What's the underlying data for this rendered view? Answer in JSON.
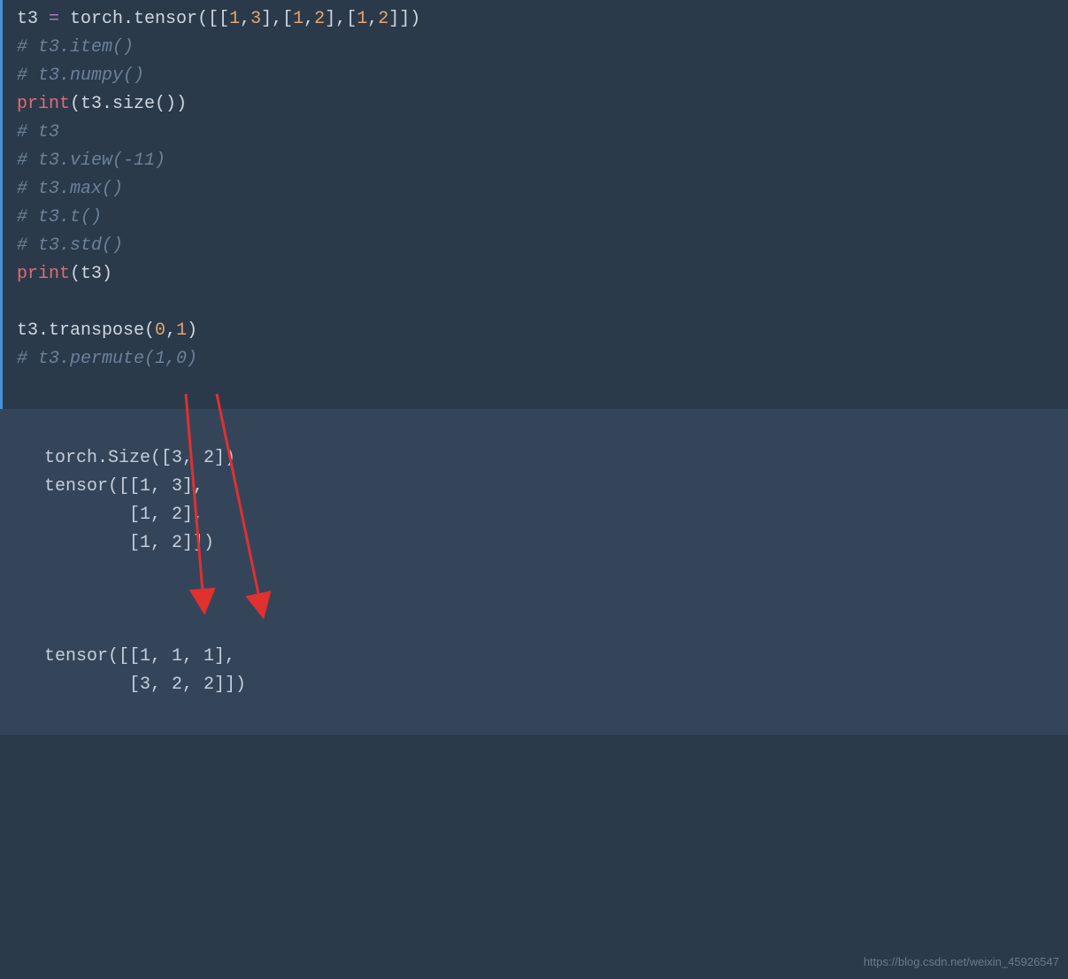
{
  "code": {
    "line1": {
      "var": "t3",
      "op": " = ",
      "method": "torch.tensor",
      "open": "([[",
      "n1": "1",
      "c1": ",",
      "n2": "3",
      "c2": "],[",
      "n3": "1",
      "c3": ",",
      "n4": "2",
      "c4": "],[",
      "n5": "1",
      "c5": ",",
      "n6": "2",
      "close": "]])"
    },
    "line2": "# t3.item()",
    "line3": "# t3.numpy()",
    "line4": {
      "builtin": "print",
      "open": "(",
      "var": "t3.size",
      "call": "()",
      "close": ")"
    },
    "line5": "# t3",
    "line6": "# t3.view(-11)",
    "line7": "# t3.max()",
    "line8": "# t3.t()",
    "line9": "# t3.std()",
    "line10": {
      "builtin": "print",
      "open": "(",
      "var": "t3",
      "close": ")"
    },
    "line11": "",
    "line12": {
      "var": "t3.transpose",
      "open": "(",
      "n1": "0",
      "c1": ",",
      "n2": "1",
      "close": ")"
    },
    "line13": "# t3.permute(1,0)"
  },
  "output": {
    "l1": "torch.Size([3, 2])",
    "l2": "tensor([[1, 3],",
    "l3": "        [1, 2],",
    "l4": "        [1, 2]])",
    "l5": "",
    "l6": "",
    "l7": "",
    "l8": "tensor([[1, 1, 1],",
    "l9": "        [3, 2, 2]])"
  },
  "watermark": "https://blog.csdn.net/weixin_45926547"
}
